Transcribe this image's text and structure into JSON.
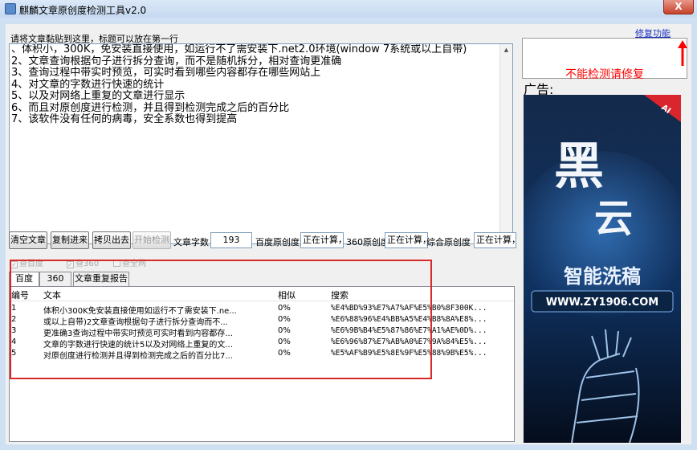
{
  "window": {
    "title": "麒麟文章原创度检测工具v2.0",
    "close_glyph": "X"
  },
  "editor": {
    "hint": "请将文章黏贴到这里，标题可以放在第一行",
    "lines": [
      "、体积小，300K，免安装直接使用，如运行不了需安装下.net2.0环境(window 7系统或以上自带)",
      "2、文章查询根据句子进行拆分查询，而不是随机拆分，相对查询更准确",
      "3、查询过程中带实时预览，可实时看到哪些内容都存在哪些网站上",
      "4、对文章的字数进行快速的统计",
      "5、以及对网络上重复的文章进行显示",
      "6、而且对原创度进行检测，并且得到检测完成之后的百分比",
      "7、该软件没有任何的病毒，安全系数也得到提高"
    ]
  },
  "toolbar": {
    "clear_label": "清空文章",
    "paste_label": "复制进来",
    "copy_out_label": "拷贝出去",
    "start_label": "开始检测",
    "word_count_label": "文章字数",
    "word_count_value": "193",
    "baidu_label": "百度原创度",
    "baidu_value": "正在计算，请稍候",
    "s360_label": "360原创度",
    "s360_value": "正在计算，请稍候",
    "overall_label": "综合原创度",
    "overall_value": "正在计算，请稍候"
  },
  "options": {
    "check_baidu": "查百度",
    "check_360": "查360",
    "check_all": "查全网"
  },
  "tabs": [
    "百度",
    "360",
    "文章重复报告"
  ],
  "results": {
    "columns": [
      "编号",
      "文本",
      "相似",
      "搜索"
    ],
    "rows": [
      {
        "id": "1",
        "text": "体积小300K免安装直接使用如运行不了需安装下.ne...",
        "sim": "0%",
        "query": "%E4%BD%93%E7%A7%AF%E5%B0%8F300K..."
      },
      {
        "id": "2",
        "text": "或以上自带)2文章查询根据句子进行拆分查询而不...",
        "sim": "0%",
        "query": "%E6%88%96%E4%BB%A5%E4%B8%8A%E8%..."
      },
      {
        "id": "3",
        "text": "更准确3查询过程中带实时预览可实时看到内容都存...",
        "sim": "0%",
        "query": "%E6%9B%B4%E5%87%86%E7%A1%AE%0D%..."
      },
      {
        "id": "4",
        "text": "文章的字数进行快速的统计5以及对网络上重复的文...",
        "sim": "0%",
        "query": "%E6%96%87%E7%AB%A0%E7%9A%84%E5%..."
      },
      {
        "id": "5",
        "text": "对原创度进行检测并且得到检测完成之后的百分比7...",
        "sim": "0%",
        "query": "%E5%AF%B9%E5%8E%9F%E5%88%9B%E5%..."
      }
    ]
  },
  "side": {
    "repair_link": "修复功能",
    "warning": "不能检测请修复",
    "ad_label": "广告:",
    "ad_badge": "AI",
    "ad_brand_1": "黑",
    "ad_brand_2": "云",
    "ad_slogan": "智能洗稿",
    "ad_url": "WWW.ZY1906.COM"
  },
  "colors": {
    "highlight_frame": "#d82929",
    "warning_text": "#ff0000",
    "link": "#1a33c0"
  }
}
